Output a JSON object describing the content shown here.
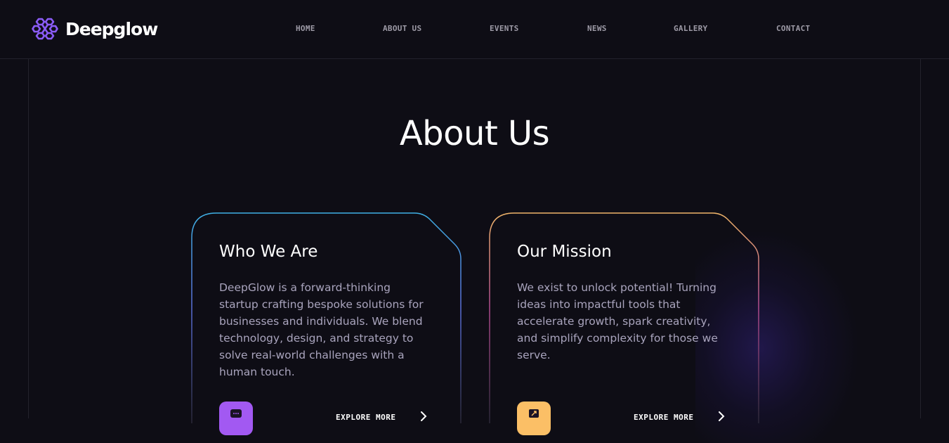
{
  "brand": {
    "name": "Deepglow",
    "logo_icon": "brain-icon",
    "accent": "#8b5cf6"
  },
  "nav": {
    "items": [
      {
        "label": "HOME"
      },
      {
        "label": "ABOUT US"
      },
      {
        "label": "EVENTS"
      },
      {
        "label": "NEWS"
      },
      {
        "label": "GALLERY"
      },
      {
        "label": "CONTACT"
      }
    ]
  },
  "section": {
    "title": "About Us"
  },
  "cards": [
    {
      "title": "Who We Are",
      "body": "DeepGlow is a forward-thinking startup crafting bespoke solutions for businesses and individuals. We blend technology, design, and strategy to solve real-world challenges with a human touch.",
      "icon": "chat-bubble-icon",
      "icon_color": "#a259f2",
      "border_colors": [
        "#3fb1e6",
        "#8b4fd8"
      ],
      "cta": "EXPLORE MORE"
    },
    {
      "title": "Our Mission",
      "body": "We exist to unlock potential! Turning ideas into impactful tools that accelerate growth, spark creativity, and simplify complexity for those we serve.",
      "icon": "expand-arrows-icon",
      "icon_color": "#fbbf66",
      "border_colors": [
        "#f0b56a",
        "#b04b8e"
      ],
      "cta": "EXPLORE MORE"
    }
  ]
}
